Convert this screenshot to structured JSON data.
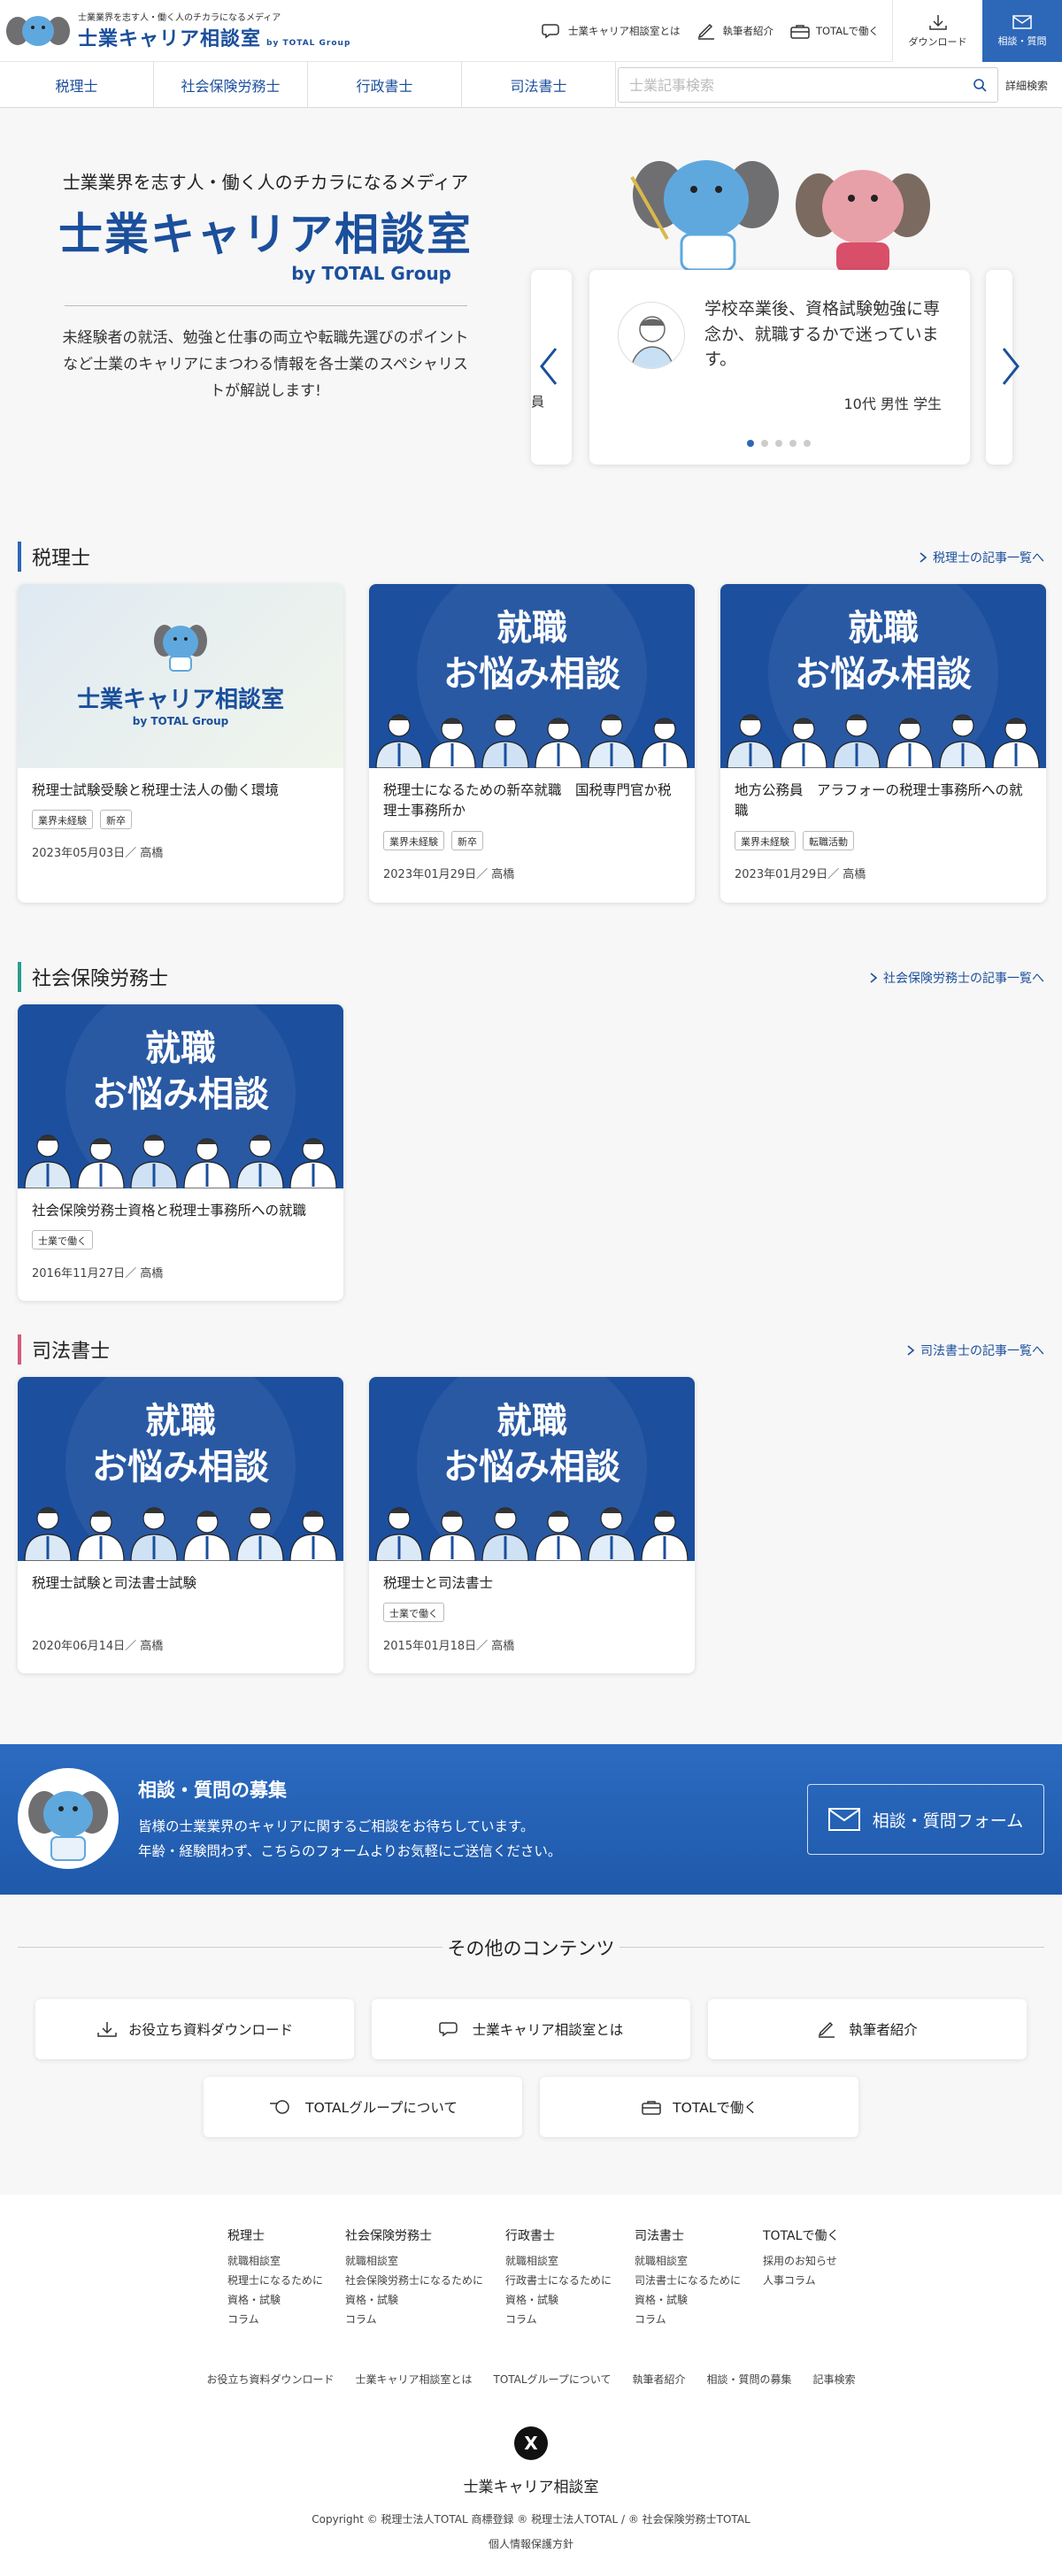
{
  "header": {
    "tagline": "士業業界を志す人・働く人のチカラになるメディア",
    "site_title": "士業キャリア相談室",
    "by_line": "by TOTAL Group",
    "links": [
      "士業キャリア相談室とは",
      "執筆者紹介",
      "TOTALで働く"
    ],
    "download_label": "ダウンロード",
    "consult_label": "相談・質問"
  },
  "nav": {
    "items": [
      "税理士",
      "社会保険労務士",
      "行政書士",
      "司法書士"
    ],
    "search_placeholder": "士業記事検索",
    "detail_search": "詳細検索"
  },
  "hero": {
    "subtitle": "士業業界を志す人・働く人のチカラになるメディア",
    "title": "士業キャリア相談室",
    "by_line": "by TOTAL Group",
    "description": "未経験者の就活、勉強と仕事の両立や転職先選びのポイントなど士業のキャリアにまつわる情報を各士業のスペシャリストが解説します!",
    "slide": {
      "question": "学校卒業後、資格試験勉強に専念か、就職するかで迷っています。",
      "meta": "10代 男性 学生",
      "ghost_left_text": "員",
      "dot_count": 5,
      "active_dot": 0
    }
  },
  "sections": [
    {
      "title": "税理士",
      "more": "税理士の記事一覧へ",
      "accent": "#2d67b8",
      "cards": [
        {
          "thumb": "logo",
          "title": "税理士試験受験と税理士法人の働く環境",
          "tags": [
            "業界未経験",
            "新卒"
          ],
          "meta": "2023年05月03日／ 高橋"
        },
        {
          "thumb": "job",
          "title": "税理士になるための新卒就職　国税専門官か税理士事務所か",
          "tags": [
            "業界未経験",
            "新卒"
          ],
          "meta": "2023年01月29日／ 高橋"
        },
        {
          "thumb": "job",
          "title": "地方公務員　アラフォーの税理士事務所への就職",
          "tags": [
            "業界未経験",
            "転職活動"
          ],
          "meta": "2023年01月29日／ 高橋"
        }
      ]
    },
    {
      "title": "社会保険労務士",
      "more": "社会保険労務士の記事一覧へ",
      "accent": "#2a9d8f",
      "cards": [
        {
          "thumb": "job",
          "title": "社会保険労務士資格と税理士事務所への就職",
          "tags": [
            "士業で働く"
          ],
          "meta": "2016年11月27日／ 高橋"
        }
      ]
    },
    {
      "title": "司法書士",
      "more": "司法書士の記事一覧へ",
      "accent": "#d45a7a",
      "cards": [
        {
          "thumb": "job",
          "title": "税理士試験と司法書士試験",
          "tags": [],
          "meta": "2020年06月14日／ 高橋"
        },
        {
          "thumb": "job",
          "title": "税理士と司法書士",
          "tags": [
            "士業で働く"
          ],
          "meta": "2015年01月18日／ 高橋"
        }
      ]
    }
  ],
  "thumb_text": {
    "line1": "就職",
    "line2": "お悩み相談",
    "logo_title": "士業キャリア相談室",
    "logo_by": "by TOTAL Group"
  },
  "banner": {
    "title": "相談・質問の募集",
    "desc1": "皆様の士業業界のキャリアに関するご相談をお待ちしています。",
    "desc2": "年齢・経験問わず、こちらのフォームよりお気軽にご送信ください。",
    "button": "相談・質問フォーム"
  },
  "other": {
    "title": "その他のコンテンツ",
    "buttons": [
      "お役立ち資料ダウンロード",
      "士業キャリア相談室とは",
      "執筆者紹介",
      "TOTALグループについて",
      "TOTALで働く"
    ]
  },
  "footer": {
    "columns": [
      {
        "head": "税理士",
        "items": [
          "就職相談室",
          "税理士になるために",
          "資格・試験",
          "コラム"
        ]
      },
      {
        "head": "社会保険労務士",
        "items": [
          "就職相談室",
          "社会保険労務士になるために",
          "資格・試験",
          "コラム"
        ]
      },
      {
        "head": "行政書士",
        "items": [
          "就職相談室",
          "行政書士になるために",
          "資格・試験",
          "コラム"
        ]
      },
      {
        "head": "司法書士",
        "items": [
          "就職相談室",
          "司法書士になるために",
          "資格・試験",
          "コラム"
        ]
      },
      {
        "head": "TOTALで働く",
        "items": [
          "採用のお知らせ",
          "人事コラム"
        ]
      }
    ],
    "links": [
      "お役立ち資料ダウンロード",
      "士業キャリア相談室とは",
      "TOTALグループについて",
      "執筆者紹介",
      "相談・質問の募集",
      "記事検索"
    ],
    "x_icon": "X",
    "site_name": "士業キャリア相談室",
    "copyright": "Copyright © 税理士法人TOTAL 商標登録 ® 税理士法人TOTAL / ® 社会保険労務士TOTAL",
    "privacy": "個人情報保護方針"
  },
  "colors": {
    "brand": "#1b4f9c",
    "accent": "#2d67b8",
    "thumb_bg": "#1c4f9e"
  }
}
